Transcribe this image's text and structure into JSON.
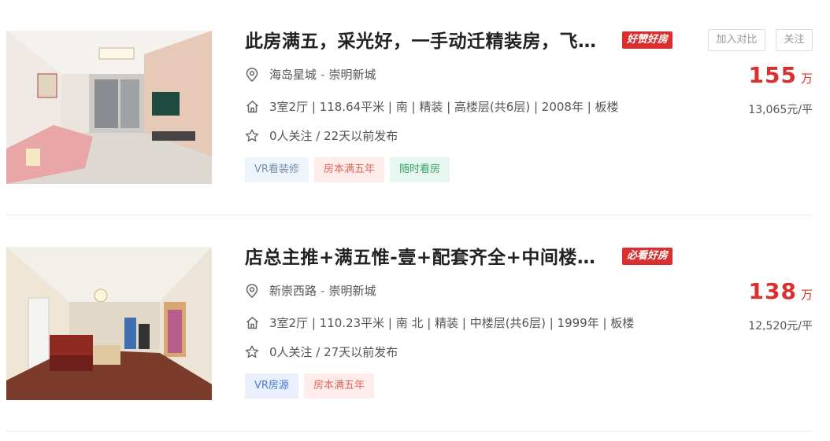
{
  "listings": [
    {
      "title": "此房满五，采光好，一手动迁精装房，飞…",
      "badge": "好赞好房",
      "compare_label": "加入对比",
      "follow_label": "关注",
      "community": "海岛星城",
      "district": "崇明新城",
      "info": "3室2厅 | 118.64平米 | 南 | 精装 | 高楼层(共6层) | 2008年 | 板楼",
      "follow_info": "0人关注 / 22天以前发布",
      "tags": [
        "VR看装修",
        "房本满五年",
        "随时看房"
      ],
      "price": "155",
      "price_unit": "万",
      "unit_price": "13,065元/平"
    },
    {
      "title": "店总主推+满五惟-壹+配套齐全+中间楼…",
      "badge": "必看好房",
      "community": "新崇西路",
      "district": "崇明新城",
      "info": "3室2厅 | 110.23平米 | 南 北 | 精装 | 中楼层(共6层) | 1999年 | 板楼",
      "follow_info": "0人关注 / 27天以前发布",
      "tags": [
        "VR房源",
        "房本满五年"
      ],
      "price": "138",
      "price_unit": "万",
      "unit_price": "12,520元/平"
    }
  ],
  "address_separator": "-",
  "icons": {
    "location": "location-pin-icon",
    "house": "house-icon",
    "star": "star-icon"
  },
  "colors": {
    "price": "#d9302f",
    "badge": "#d9302f"
  }
}
